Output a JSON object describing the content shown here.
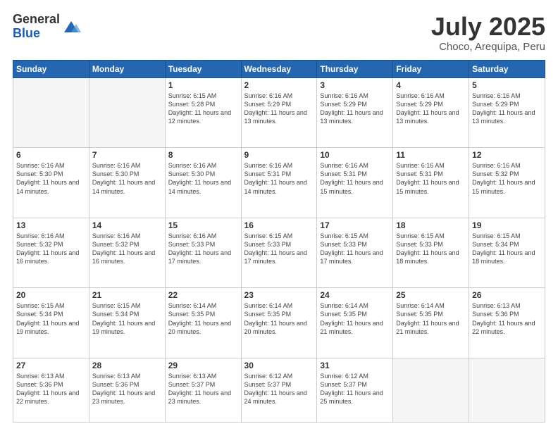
{
  "header": {
    "logo_general": "General",
    "logo_blue": "Blue",
    "title": "July 2025",
    "location": "Choco, Arequipa, Peru"
  },
  "weekdays": [
    "Sunday",
    "Monday",
    "Tuesday",
    "Wednesday",
    "Thursday",
    "Friday",
    "Saturday"
  ],
  "weeks": [
    [
      {
        "day": "",
        "info": ""
      },
      {
        "day": "",
        "info": ""
      },
      {
        "day": "1",
        "info": "Sunrise: 6:15 AM\nSunset: 5:28 PM\nDaylight: 11 hours and 12 minutes."
      },
      {
        "day": "2",
        "info": "Sunrise: 6:16 AM\nSunset: 5:29 PM\nDaylight: 11 hours and 13 minutes."
      },
      {
        "day": "3",
        "info": "Sunrise: 6:16 AM\nSunset: 5:29 PM\nDaylight: 11 hours and 13 minutes."
      },
      {
        "day": "4",
        "info": "Sunrise: 6:16 AM\nSunset: 5:29 PM\nDaylight: 11 hours and 13 minutes."
      },
      {
        "day": "5",
        "info": "Sunrise: 6:16 AM\nSunset: 5:29 PM\nDaylight: 11 hours and 13 minutes."
      }
    ],
    [
      {
        "day": "6",
        "info": "Sunrise: 6:16 AM\nSunset: 5:30 PM\nDaylight: 11 hours and 14 minutes."
      },
      {
        "day": "7",
        "info": "Sunrise: 6:16 AM\nSunset: 5:30 PM\nDaylight: 11 hours and 14 minutes."
      },
      {
        "day": "8",
        "info": "Sunrise: 6:16 AM\nSunset: 5:30 PM\nDaylight: 11 hours and 14 minutes."
      },
      {
        "day": "9",
        "info": "Sunrise: 6:16 AM\nSunset: 5:31 PM\nDaylight: 11 hours and 14 minutes."
      },
      {
        "day": "10",
        "info": "Sunrise: 6:16 AM\nSunset: 5:31 PM\nDaylight: 11 hours and 15 minutes."
      },
      {
        "day": "11",
        "info": "Sunrise: 6:16 AM\nSunset: 5:31 PM\nDaylight: 11 hours and 15 minutes."
      },
      {
        "day": "12",
        "info": "Sunrise: 6:16 AM\nSunset: 5:32 PM\nDaylight: 11 hours and 15 minutes."
      }
    ],
    [
      {
        "day": "13",
        "info": "Sunrise: 6:16 AM\nSunset: 5:32 PM\nDaylight: 11 hours and 16 minutes."
      },
      {
        "day": "14",
        "info": "Sunrise: 6:16 AM\nSunset: 5:32 PM\nDaylight: 11 hours and 16 minutes."
      },
      {
        "day": "15",
        "info": "Sunrise: 6:16 AM\nSunset: 5:33 PM\nDaylight: 11 hours and 17 minutes."
      },
      {
        "day": "16",
        "info": "Sunrise: 6:15 AM\nSunset: 5:33 PM\nDaylight: 11 hours and 17 minutes."
      },
      {
        "day": "17",
        "info": "Sunrise: 6:15 AM\nSunset: 5:33 PM\nDaylight: 11 hours and 17 minutes."
      },
      {
        "day": "18",
        "info": "Sunrise: 6:15 AM\nSunset: 5:33 PM\nDaylight: 11 hours and 18 minutes."
      },
      {
        "day": "19",
        "info": "Sunrise: 6:15 AM\nSunset: 5:34 PM\nDaylight: 11 hours and 18 minutes."
      }
    ],
    [
      {
        "day": "20",
        "info": "Sunrise: 6:15 AM\nSunset: 5:34 PM\nDaylight: 11 hours and 19 minutes."
      },
      {
        "day": "21",
        "info": "Sunrise: 6:15 AM\nSunset: 5:34 PM\nDaylight: 11 hours and 19 minutes."
      },
      {
        "day": "22",
        "info": "Sunrise: 6:14 AM\nSunset: 5:35 PM\nDaylight: 11 hours and 20 minutes."
      },
      {
        "day": "23",
        "info": "Sunrise: 6:14 AM\nSunset: 5:35 PM\nDaylight: 11 hours and 20 minutes."
      },
      {
        "day": "24",
        "info": "Sunrise: 6:14 AM\nSunset: 5:35 PM\nDaylight: 11 hours and 21 minutes."
      },
      {
        "day": "25",
        "info": "Sunrise: 6:14 AM\nSunset: 5:35 PM\nDaylight: 11 hours and 21 minutes."
      },
      {
        "day": "26",
        "info": "Sunrise: 6:13 AM\nSunset: 5:36 PM\nDaylight: 11 hours and 22 minutes."
      }
    ],
    [
      {
        "day": "27",
        "info": "Sunrise: 6:13 AM\nSunset: 5:36 PM\nDaylight: 11 hours and 22 minutes."
      },
      {
        "day": "28",
        "info": "Sunrise: 6:13 AM\nSunset: 5:36 PM\nDaylight: 11 hours and 23 minutes."
      },
      {
        "day": "29",
        "info": "Sunrise: 6:13 AM\nSunset: 5:37 PM\nDaylight: 11 hours and 23 minutes."
      },
      {
        "day": "30",
        "info": "Sunrise: 6:12 AM\nSunset: 5:37 PM\nDaylight: 11 hours and 24 minutes."
      },
      {
        "day": "31",
        "info": "Sunrise: 6:12 AM\nSunset: 5:37 PM\nDaylight: 11 hours and 25 minutes."
      },
      {
        "day": "",
        "info": ""
      },
      {
        "day": "",
        "info": ""
      }
    ]
  ]
}
